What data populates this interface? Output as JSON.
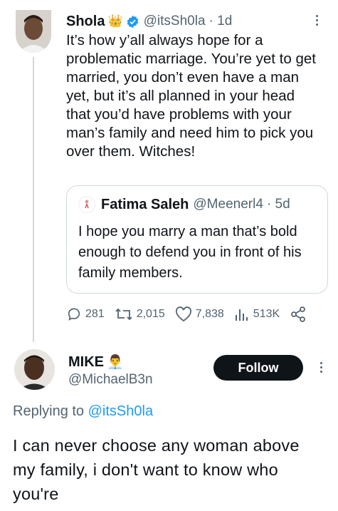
{
  "tweet1": {
    "name": "Shola",
    "badge_emoji": "👑",
    "handle": "@itsSh0la",
    "time": "· 1d",
    "text": "It’s how y’all always hope for a problematic marriage. You’re yet to get married, you don’t even have a man yet, but it’s all planned in your head that you’d have problems with your man’s family and need him to pick you over them. Witches!",
    "quote": {
      "name": "Fatima Saleh",
      "handle": "@Meenerl4",
      "time": "· 5d",
      "text": "I hope you marry a man that’s bold enough to defend you in front of his family members."
    },
    "stats": {
      "replies": "281",
      "retweets": "2,015",
      "likes": "7,838",
      "views": "513K"
    }
  },
  "tweet2": {
    "name": "MIKE",
    "badge_emoji": "👨‍💼",
    "handle": "@MichaelB3n",
    "follow_label": "Follow",
    "replying_prefix": "Replying to",
    "replying_mention": "@itsSh0la",
    "text": "I can never choose any woman above my family, i don't want to know who you're"
  },
  "colors": {
    "text": "#0f1419",
    "secondary": "#536471",
    "link": "#1d9bf0",
    "verified": "#1d9bf0",
    "follow_bg": "#0f1419",
    "border": "#cfd9de"
  }
}
